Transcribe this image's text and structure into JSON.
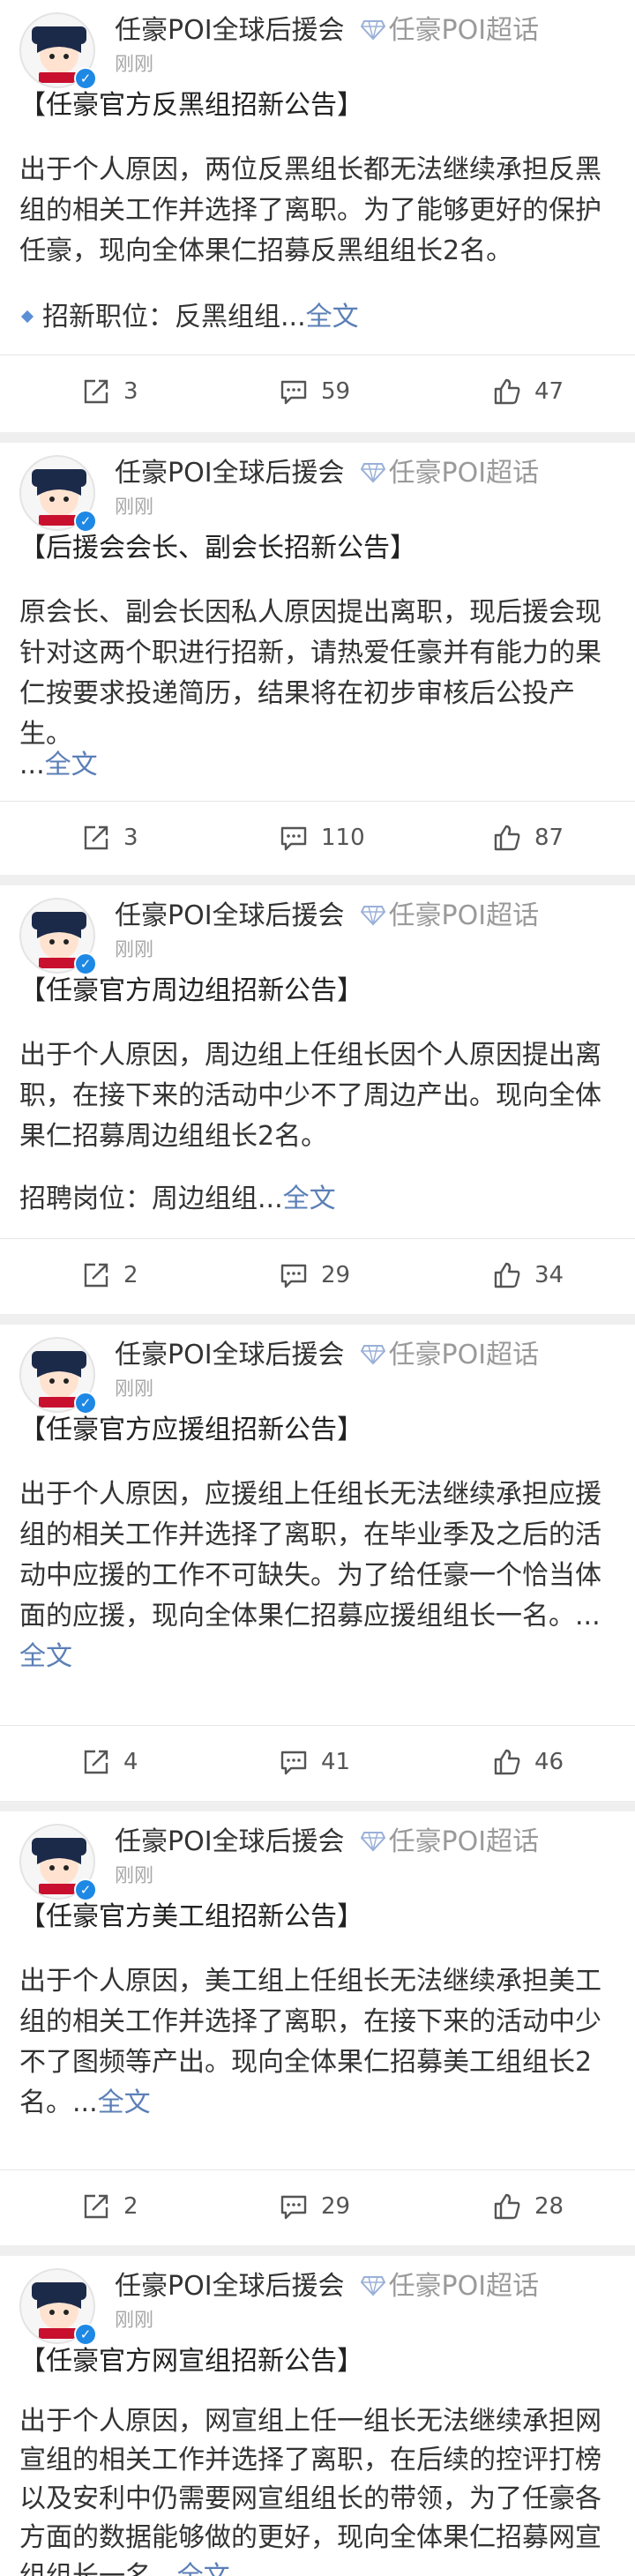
{
  "posts": [
    {
      "author": "任豪POI全球后援会",
      "topic": "任豪POI超话",
      "time": "刚刚",
      "title": "【任豪官方反黑组招新公告】",
      "body": "出于个人原因，两位反黑组长都无法继续承担反黑组的相关工作并选择了离职。为了能够更好的保护任豪，现向全体果仁招募反黑组组长2名。",
      "extra_text": "招新职位：反黑组组...",
      "extra_has_bullet": true,
      "more_label": "全文",
      "reposts": "3",
      "comments": "59",
      "likes": "47"
    },
    {
      "author": "任豪POI全球后援会",
      "topic": "任豪POI超话",
      "time": "刚刚",
      "title": "【后援会会长、副会长招新公告】",
      "body": "原会长、副会长因私人原因提出离职，现后援会现针对这两个职进行招新，请热爱任豪并有能力的果仁按要求投递简历，结果将在初步审核后公投产生。",
      "extra_text": "...",
      "extra_has_bullet": false,
      "more_label": "全文",
      "reposts": "3",
      "comments": "110",
      "likes": "87"
    },
    {
      "author": "任豪POI全球后援会",
      "topic": "任豪POI超话",
      "time": "刚刚",
      "title": "【任豪官方周边组招新公告】",
      "body": "出于个人原因，周边组上任组长因个人原因提出离职，在接下来的活动中少不了周边产出。现向全体果仁招募周边组组长2名。",
      "extra_text": "招聘岗位：周边组组...",
      "extra_has_bullet": false,
      "more_label": "全文",
      "reposts": "2",
      "comments": "29",
      "likes": "34"
    },
    {
      "author": "任豪POI全球后援会",
      "topic": "任豪POI超话",
      "time": "刚刚",
      "title": "【任豪官方应援组招新公告】",
      "body": "出于个人原因，应援组上任组长无法继续承担应援组的相关工作并选择了离职，在毕业季及之后的活动中应援的工作不可缺失。为了给任豪一个恰当体面的应援，现向全体果仁招募应援组组长一名。...",
      "extra_text": "",
      "extra_has_bullet": false,
      "more_label": "全文",
      "reposts": "4",
      "comments": "41",
      "likes": "46"
    },
    {
      "author": "任豪POI全球后援会",
      "topic": "任豪POI超话",
      "time": "刚刚",
      "title": "【任豪官方美工组招新公告】",
      "body": "出于个人原因，美工组上任组长无法继续承担美工组的相关工作并选择了离职，在接下来的活动中少不了图频等产出。现向全体果仁招募美工组组长2名。...",
      "extra_text": "",
      "extra_has_bullet": false,
      "more_label": "全文",
      "reposts": "2",
      "comments": "29",
      "likes": "28"
    },
    {
      "author": "任豪POI全球后援会",
      "topic": "任豪POI超话",
      "time": "刚刚",
      "title": "【任豪官方网宣组招新公告】",
      "body": "出于个人原因，网宣组上任一组长无法继续承担网宣组的相关工作并选择了离职，在后续的控评打榜以及安利中仍需要网宣组组长的带领，为了任豪各方面的数据能够做的更好，现向全体果仁招募网宣组组长一名...",
      "extra_text": "",
      "extra_has_bullet": false,
      "more_label": "全文"
    }
  ],
  "colors": {
    "background": "#efefef",
    "card": "#ffffff",
    "link": "#5b7fb7",
    "verified": "#1e88e5",
    "topic_diamond": "#5b8fd6",
    "muted": "#a8a8a8"
  },
  "icons": {
    "avatar": "avatar-cartoon-boy",
    "verified": "verified-badge-icon",
    "topic": "super-topic-diamond-icon",
    "repost": "repost-icon",
    "comment": "comment-icon",
    "like": "like-thumb-icon"
  }
}
